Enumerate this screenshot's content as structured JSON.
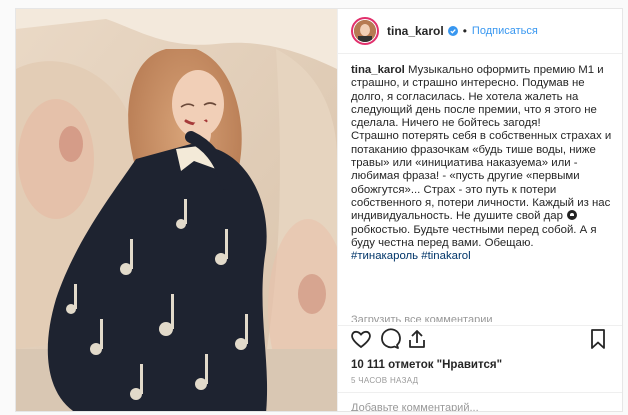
{
  "post": {
    "username": "tina_karol",
    "follow_label": "Подписаться",
    "separator": "•",
    "caption": {
      "author": "tina_karol",
      "lines": [
        "Музыкально оформить премию М1 и страшно, и страшно интересно. Подумав не долго, я согласилась. Не хотела жалеть на следующий день после премии, что я этого не сделала. Ничего не бойтесь загодя!",
        "Страшно потерять себя в собственных страхах и потаканию фразочкам «будь тише воды, ниже травы» или «инициатива наказуема» или - любимая фраза! - «пусть другие «первыми обожгутся»... Страх - это путь к потери собственного я, потери личности. Каждый из нас индивидуальность. Не душите свой дар",
        "робкостью. Будьте честными перед собой. А я буду честна перед вами. Обещаю."
      ],
      "hashtags": [
        "#тинакароль",
        "#tinakarol"
      ]
    },
    "load_more": "Загрузить все комментарии",
    "likes": "10 111 отметок \"Нравится\"",
    "time_ago": "5 часов назад",
    "comment_placeholder": "Добавьте комментарий...",
    "icons": [
      "verified-badge-icon",
      "heart-icon",
      "comment-icon",
      "share-icon",
      "bookmark-icon",
      "emoji-icon"
    ],
    "colors": {
      "link": "#003569",
      "accent": "#3897f0",
      "muted": "#999999",
      "verified": "#3897f0"
    }
  }
}
